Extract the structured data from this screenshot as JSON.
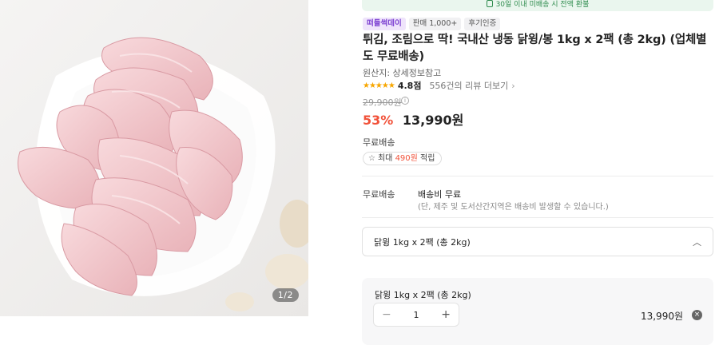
{
  "gallery": {
    "page_indicator": "1/2"
  },
  "notice": {
    "text": "30일 이내 미배송 시 전액 환불"
  },
  "badges": [
    {
      "label": "떠들썩데이"
    },
    {
      "label": "판매 1,000+"
    },
    {
      "label": "후기인증"
    }
  ],
  "product": {
    "title": "튀김, 조림으로 딱! 국내산 냉동 닭윙/봉 1kg x 2팩 (총 2kg) (업체별도 무료배송)",
    "origin": "원산지: 상세정보참고",
    "rating_stars": "★★★★★",
    "rating": "4.8점",
    "reviews": "556건의 리뷰 더보기",
    "original_price": "29,900원",
    "discount": "53%",
    "price": "13,990원"
  },
  "shipping": {
    "title": "무료배송",
    "points_prefix": "최대",
    "points_amount": "490원",
    "points_suffix": "적립",
    "delivery_label": "무료배송",
    "delivery_value": "배송비 무료",
    "delivery_note": "(단, 제주 및 도서산간지역은 배송비 발생할 수 있습니다.)"
  },
  "option_select": {
    "selected": "닭윙 1kg x 2팩 (총 2kg)"
  },
  "selected_option": {
    "name": "닭윙 1kg x 2팩 (총 2kg)",
    "quantity": "1",
    "minus": "−",
    "plus": "+",
    "price": "13,990원",
    "remove": "×"
  },
  "colors": {
    "accent_red": "#f1523a",
    "badge_purple": "#7b3fd1",
    "notice_green": "#2f8c4e",
    "star": "#f7a600"
  }
}
